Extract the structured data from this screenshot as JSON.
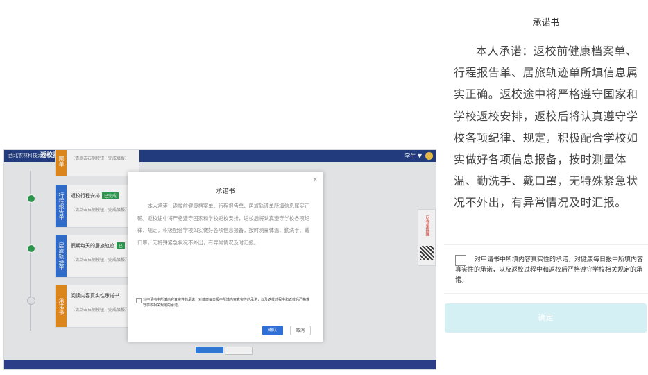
{
  "desktop": {
    "header": {
      "logo_text": "西北农林科技大学",
      "title": "返校报备管理",
      "user_label": "学生 ▼"
    },
    "steps": [
      {
        "tag": "案单",
        "title": "",
        "badge": "",
        "sub": "（请点击右侧按钮，完成填报）"
      },
      {
        "tag": "行程报告单",
        "title": "返校行程安排",
        "badge": "已完成",
        "sub": "（请点击右侧按钮，完成填报）"
      },
      {
        "tag": "居旅轨迹单",
        "title": "假期每天的居旅轨迹",
        "badge": "已",
        "sub": "（请点击右侧按钮，完成填报）"
      },
      {
        "tag": "承诺书",
        "title": "阅读内容真实性承诺书",
        "badge": "",
        "sub": "（请点击右侧按钮，完成填报）"
      }
    ],
    "side_panel_text": "问卷星提醒",
    "modal": {
      "close": "×",
      "title": "承诺书",
      "body": "本人承诺：返校前健康档案单、行程报告单、居旅轨迹单所填信息属实正确。返校途中将严格遵守国家和学校返校安排，返校后将认真遵守学校各项纪律、规定，积极配合学校如实做好各项信息报备，按时测量体温、勤洗手、戴口罩，无特殊紧急状况不外出，有异常情况及时汇报。",
      "agree_text": "对申请书中所填内容真实性的承诺，对健康每日报中所填内容真实性的承诺，以及返校过程中和返校后严格遵守学校相关规定的承诺。",
      "ok_label": "确认",
      "cancel_label": "取消"
    }
  },
  "mobile": {
    "title": "承诺书",
    "body": "本人承诺：返校前健康档案单、行程报告单、居旅轨迹单所填信息属实正确。返校途中将严格遵守国家和学校返校安排，返校后将认真遵守学校各项纪律、规定，积极配合学校如实做好各项信息报备，按时测量体温、勤洗手、戴口罩，无特殊紧急状况不外出，有异常情况及时汇报。",
    "agree_text": "对申请书中所填内容真实性的承诺，对健康每日报中所填内容真实性的承诺，以及返校过程中和返校后严格遵守学校相关规定的承诺。",
    "confirm_label": "确定"
  },
  "colors": {
    "header_blue": "#1f3b83",
    "done_green": "#2b9d4e",
    "step_blue": "#2f6fd6",
    "step_orange": "#e98d1a",
    "confirm_disabled": "#d4f0f4"
  }
}
